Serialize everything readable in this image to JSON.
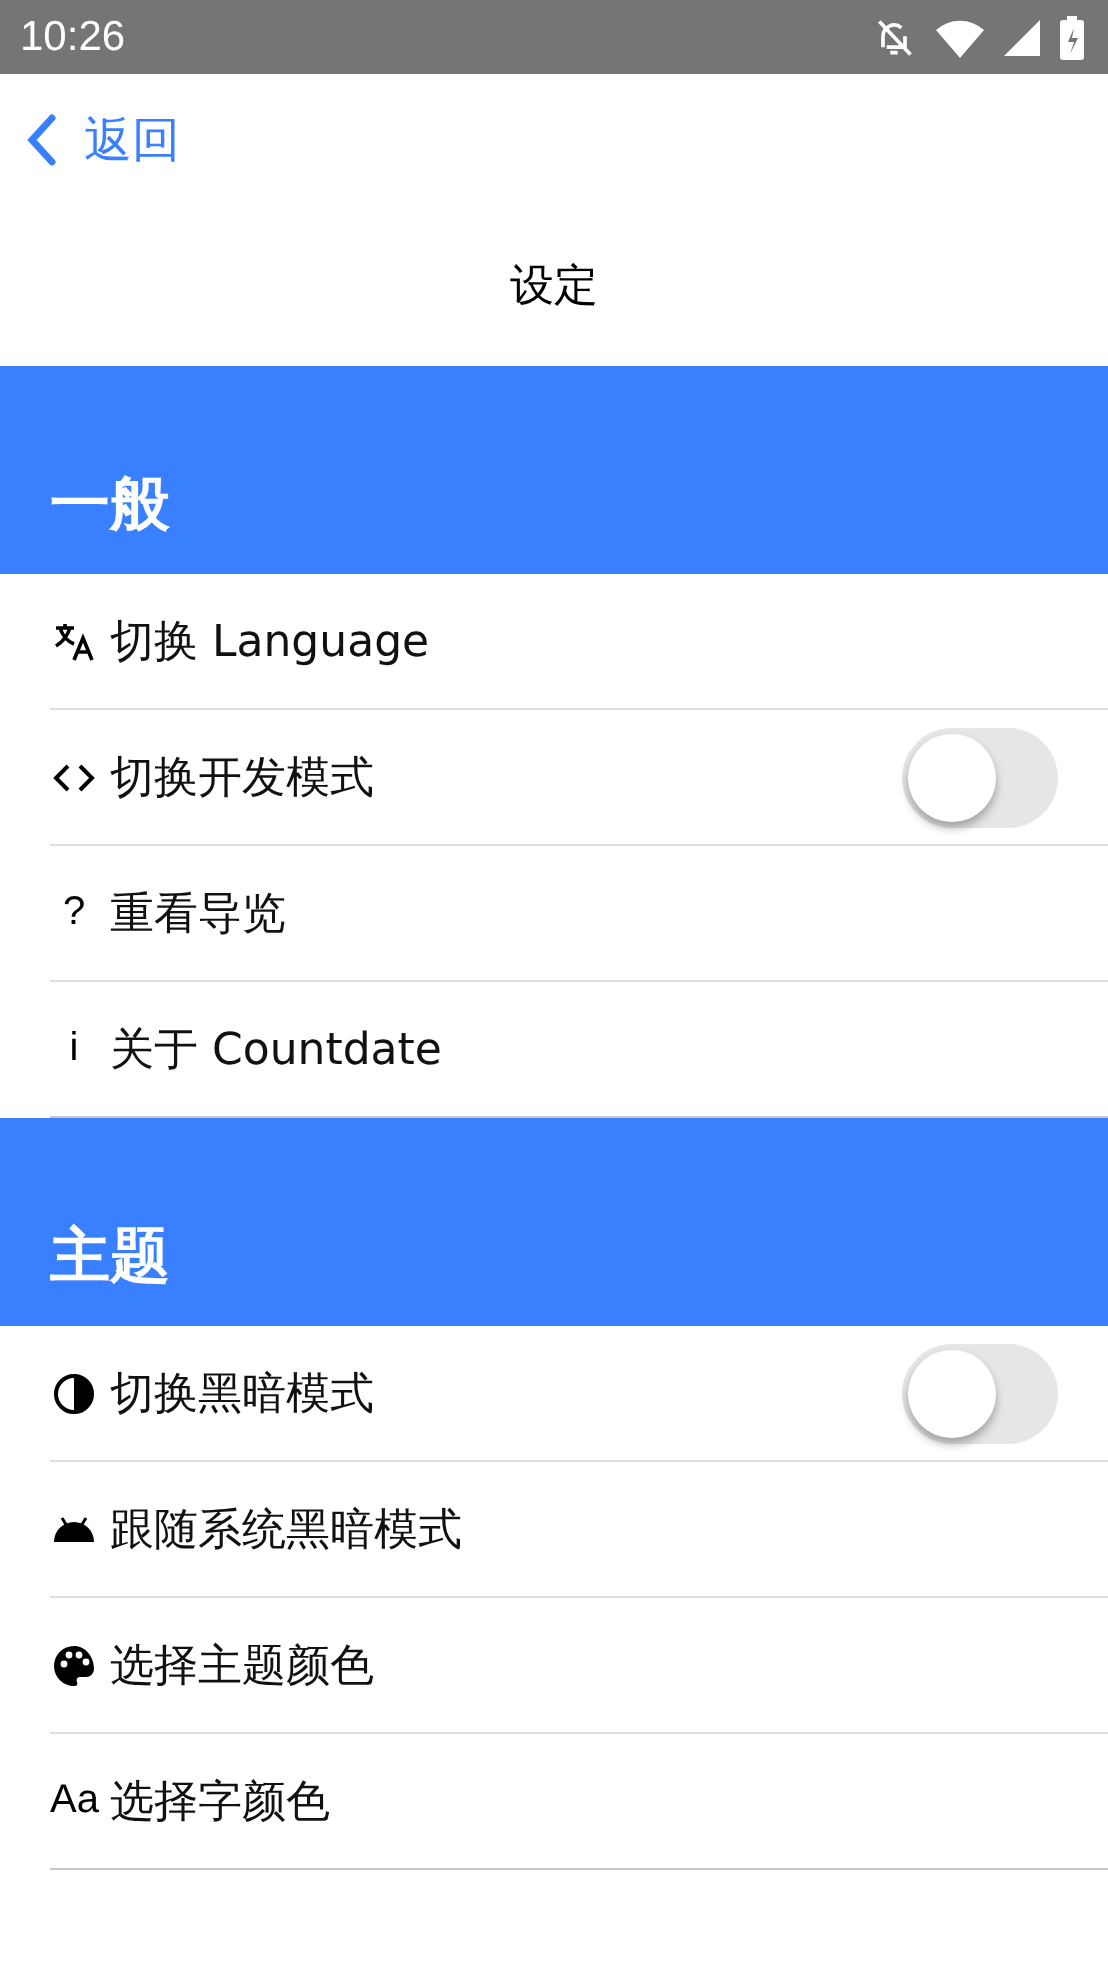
{
  "status_bar": {
    "time": "10:26"
  },
  "nav": {
    "back": "返回",
    "title": "设定"
  },
  "sections": [
    {
      "title": "一般",
      "items": [
        {
          "kind": "link",
          "label": "切换 Language"
        },
        {
          "kind": "toggle",
          "label": "切换开发模式",
          "on": false
        },
        {
          "kind": "link",
          "label": "重看导览",
          "glyph": "?"
        },
        {
          "kind": "link",
          "label": "关于 Countdate",
          "glyph": "i"
        }
      ]
    },
    {
      "title": "主题",
      "items": [
        {
          "kind": "toggle",
          "label": "切换黑暗模式",
          "on": false
        },
        {
          "kind": "link",
          "label": "跟随系统黑暗模式"
        },
        {
          "kind": "link",
          "label": "选择主题颜色"
        },
        {
          "kind": "link",
          "label": "选择字颜色",
          "glyph": "Aa"
        }
      ]
    }
  ]
}
